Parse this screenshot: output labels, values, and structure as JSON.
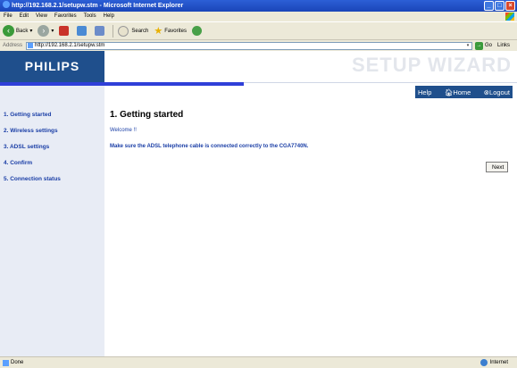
{
  "window": {
    "title": "http://192.168.2.1/setupw.stm - Microsoft Internet Explorer"
  },
  "menu": [
    "File",
    "Edit",
    "View",
    "Favorites",
    "Tools",
    "Help"
  ],
  "toolbar": {
    "back": "Back",
    "search": "Search",
    "favorites": "Favorites"
  },
  "address": {
    "label": "Address",
    "value": "http://192.168.2.1/setupw.stm",
    "go": "Go",
    "links": "Links"
  },
  "header": {
    "logo": "PHILIPS",
    "wizard_title": "SETUP WIZARD",
    "nav": {
      "help": "Help",
      "home": "Home",
      "logout": "Logout"
    }
  },
  "sidebar": {
    "items": [
      {
        "label": "1. Getting started"
      },
      {
        "label": "2. Wireless settings"
      },
      {
        "label": "3. ADSL settings"
      },
      {
        "label": "4. Confirm"
      },
      {
        "label": "5. Connection status"
      }
    ]
  },
  "main": {
    "title": "1. Getting started",
    "welcome": "Welcome !!",
    "instruction": "Make sure the ADSL telephone cable is connected correctly to the CGA7740N.",
    "next_label": "Next"
  },
  "status": {
    "text": "Done",
    "zone": "Internet"
  }
}
